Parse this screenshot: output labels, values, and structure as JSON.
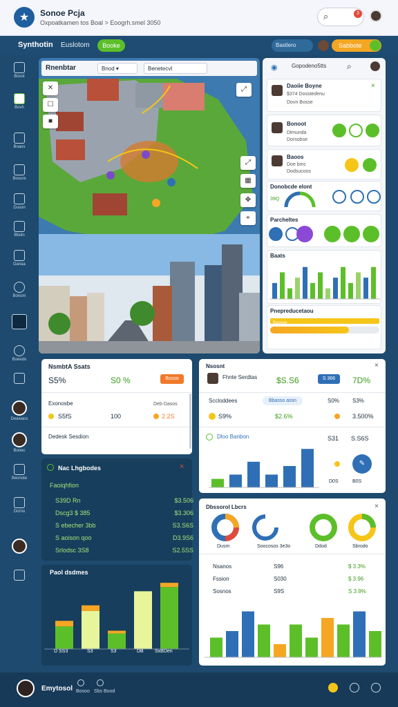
{
  "app": {
    "title": "Sonoe Pcja",
    "crumb": "Oxpoatkamen tos Boal > Eoogrh.smel 3050",
    "notifications": "3"
  },
  "nav": {
    "title": "Synthotin",
    "tab": "Euslotom",
    "pill": "Booke",
    "status": "Bastlero",
    "toggle": "Sabbote"
  },
  "sidebar": {
    "items": [
      "Bosot",
      "Bovh",
      "Boaos",
      "Booure",
      "Duson",
      "Bboln",
      "Danaa",
      "Bonom",
      "Boeedo",
      "Deawaos",
      "Bonec",
      "Beonote",
      "Dorno"
    ]
  },
  "map": {
    "title": "Rnenbtar",
    "select1": "Bnod",
    "select2": "Benetecvl"
  },
  "rpanel": {
    "search": "Gopodeno5tts",
    "c1": {
      "title": "Daoiie Boyne",
      "sub": "$374 Dosstedenu",
      "sub2": "Dovn Bosse"
    },
    "c2": {
      "title": "Bonoot",
      "sub": "Dtmunda",
      "sub2": "Dorsobse"
    },
    "c3": {
      "title": "Baoos",
      "sub": "Doe bmc",
      "sub2": "Dodsucoos"
    },
    "c4": {
      "title": "Donobcde elont",
      "val": "39Q"
    },
    "c5": {
      "title": "Parcheltes"
    },
    "c6": {
      "title": "Baats"
    },
    "c7": {
      "title": "Pnepreducetaou",
      "bar": "Baosee",
      "pct": 0.72
    }
  },
  "card1": {
    "title": "NsmbtA Ssats",
    "v1": "S5%",
    "v2": "S0 %",
    "btn": "Bosso",
    "row1": "Exonosbe",
    "row1r": "Deb Dasos",
    "a": "S5fS",
    "b": "100",
    "c": "2.2S",
    "foot": "Dedesk Sesdion"
  },
  "dark1": {
    "title": "Nac Lhgbodes",
    "sub": "Faoiqhfion",
    "rows": [
      {
        "l": "S39D Rn",
        "r": "$3.506"
      },
      {
        "l": "Dscg3 $ 385",
        "r": "$3.306"
      },
      {
        "l": "S ebecher 3bb",
        "r": "S3.S6S"
      },
      {
        "l": "S aoison qoo",
        "r": "D3.9S6"
      },
      {
        "l": "Srlodsc 3S8",
        "r": "S2.5SS"
      }
    ]
  },
  "dark2": {
    "title": "Paol dsdmes",
    "labels": [
      "D SS3",
      "S3",
      "S3",
      "DB",
      "SxBDen"
    ]
  },
  "card2": {
    "title": "Nsosnt",
    "name": "Fhnte Serdtas",
    "v1": "$S.S6",
    "tag": "S 366",
    "v2": "7D%",
    "r1": "Sccloddees",
    "r1pill": "Bbasso assn",
    "r1b": "S0%",
    "r1c": "S3%",
    "a": "S9%",
    "b": "$2.6%",
    "c": "3.500%",
    "sec": "Dloo Banbon",
    "s1": "S31",
    "s2": "S.S6S",
    "s3": "D0S",
    "s4": "B0S"
  },
  "card3": {
    "title": "Dbssorol Lbcrs",
    "donuts": [
      "Dusm",
      "Soocosos 3e3o",
      "Ddod",
      "Sbrodo"
    ],
    "rows": [
      {
        "l": "Nsanos",
        "m": "S96",
        "r": "$ 3.3%"
      },
      {
        "l": "Fssion",
        "m": "S030",
        "r": "$ 3.96"
      },
      {
        "l": "Sosnos",
        "m": "S9S",
        "r": "S 3.9%"
      }
    ]
  },
  "footer": {
    "name": "Emytosol",
    "s1": "Bosoo",
    "s2": "Sbs Bood"
  },
  "colors": {
    "brand": "#1f4c73",
    "green": "#5cbf2a",
    "orange": "#f5a623",
    "blue": "#2f6fb5",
    "yellow": "#f5c518"
  },
  "chart_data": [
    {
      "type": "bar",
      "title": "Baats",
      "series": [
        {
          "values": [
            3,
            5,
            2,
            4,
            6,
            3,
            5,
            2,
            4,
            6,
            3,
            5,
            4,
            6
          ]
        }
      ]
    },
    {
      "type": "bar",
      "title": "Paol dsdmes",
      "series": [
        {
          "values": [
            3.2,
            5.4,
            2.2,
            8.2,
            8.8
          ]
        },
        {
          "values": [
            0.8,
            0.8,
            0.4,
            0,
            0.6
          ]
        }
      ]
    },
    {
      "type": "bar",
      "title": "Dloo Banbon",
      "series": [
        {
          "values": [
            2,
            3,
            6,
            3,
            5,
            9
          ]
        }
      ]
    },
    {
      "type": "bar",
      "title": "",
      "series": [
        {
          "values": [
            3,
            4,
            7,
            5,
            2,
            5,
            3,
            6,
            5,
            7,
            4
          ]
        }
      ]
    }
  ]
}
